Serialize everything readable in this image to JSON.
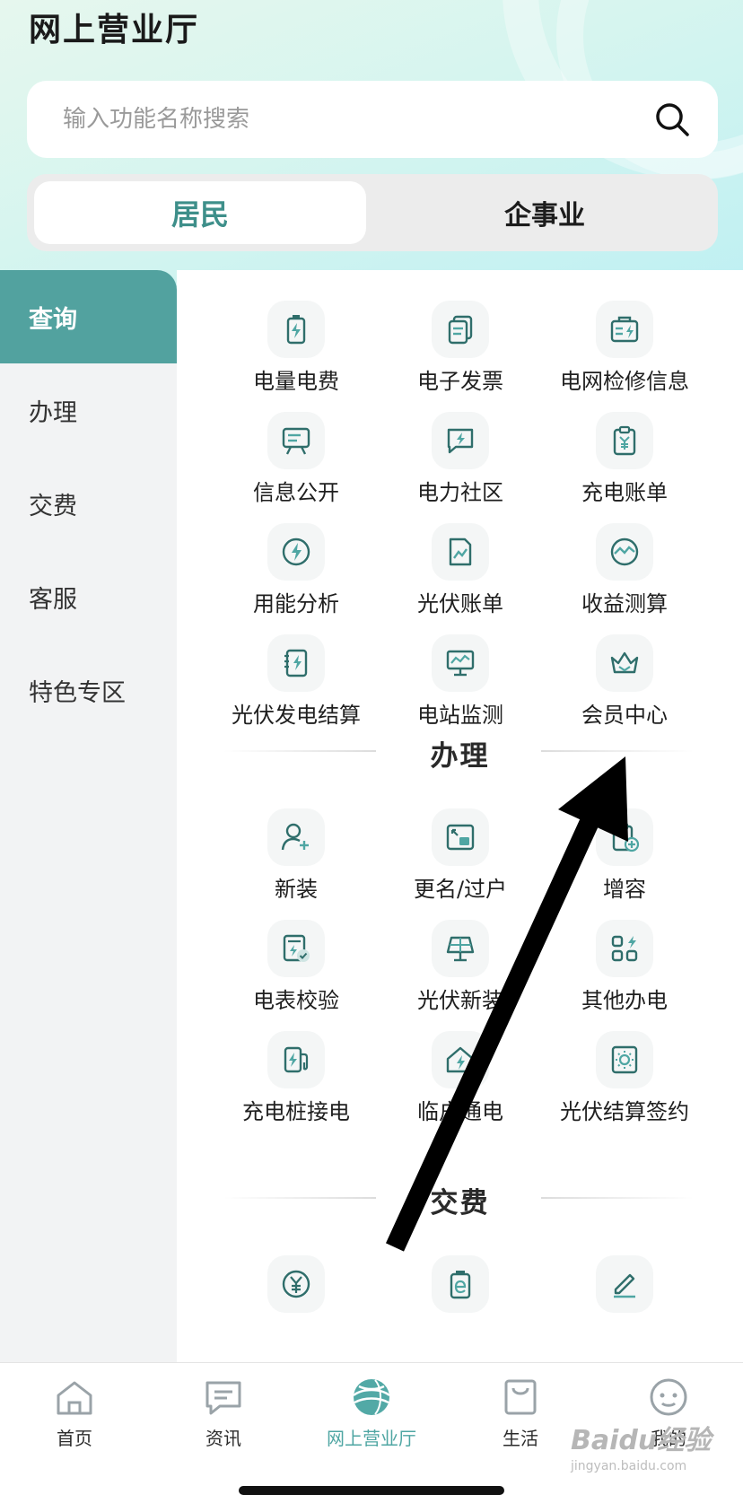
{
  "header": {
    "title": "网上营业厅"
  },
  "search": {
    "placeholder": "输入功能名称搜索"
  },
  "segment": {
    "options": [
      "居民",
      "企事业"
    ],
    "selected": "居民"
  },
  "sidebar": {
    "items": [
      "查询",
      "办理",
      "交费",
      "客服",
      "特色专区"
    ],
    "active": "查询"
  },
  "sections": {
    "query": {
      "items": [
        "电量电费",
        "电子发票",
        "电网检修信息",
        "信息公开",
        "电力社区",
        "充电账单",
        "用能分析",
        "光伏账单",
        "收益测算",
        "光伏发电结算",
        "电站监测",
        "会员中心"
      ]
    },
    "handle": {
      "title": "办理",
      "items": [
        "新装",
        "更名/过户",
        "增容",
        "电表校验",
        "光伏新装",
        "其他办电",
        "充电桩接电",
        "临户通电",
        "光伏结算签约"
      ]
    },
    "pay": {
      "title": "交费"
    }
  },
  "tabbar": {
    "items": [
      "首页",
      "资讯",
      "网上营业厅",
      "生活",
      "我的"
    ],
    "active": "网上营业厅"
  },
  "watermark": {
    "brand": "Baidu经验",
    "sub": "jingyan.baidu.com"
  },
  "colors": {
    "accent": "#52a29f",
    "accent_text": "#3e8f8a",
    "icon_stroke": "#2f6e6b"
  }
}
